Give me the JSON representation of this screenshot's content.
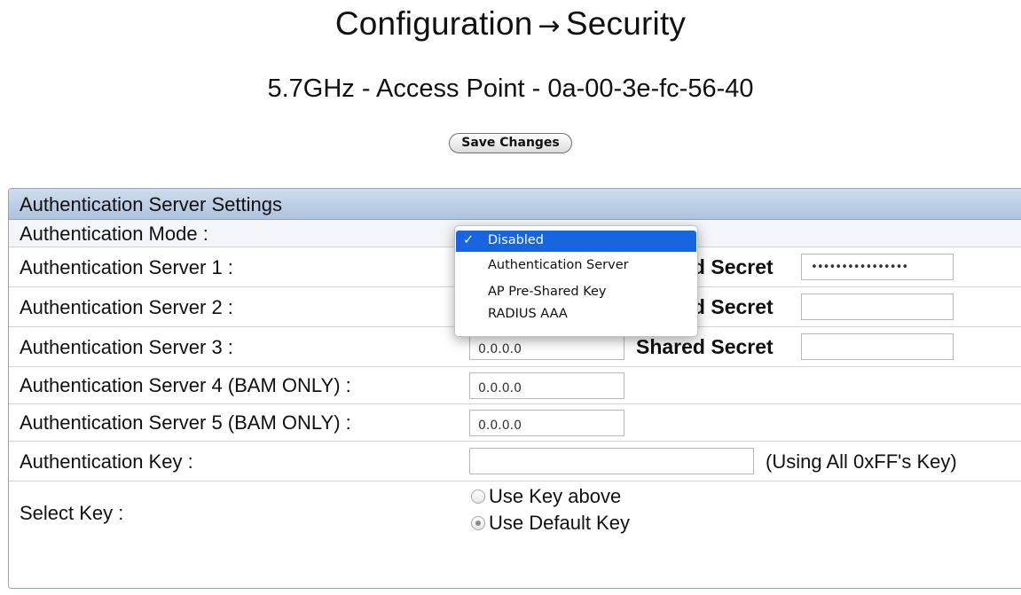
{
  "header": {
    "title_left": "Configuration",
    "title_arrow": "→",
    "title_right": "Security",
    "device": "5.7GHz - Access Point - 0a-00-3e-fc-56-40"
  },
  "toolbar": {
    "save_label": "Save Changes"
  },
  "panel": {
    "title": "Authentication Server Settings",
    "mode_label": "Authentication Mode :",
    "servers": [
      {
        "label": "Authentication Server 1 :",
        "value": "",
        "secret_label": "Shared Secret",
        "secret_value": "••••••••••••••••"
      },
      {
        "label": "Authentication Server 2 :",
        "value": "",
        "secret_label": "Shared Secret",
        "secret_value": ""
      },
      {
        "label": "Authentication Server 3 :",
        "value": "0.0.0.0",
        "secret_label": "Shared Secret",
        "secret_value": ""
      },
      {
        "label": "Authentication Server 4 (BAM ONLY) :",
        "value": "0.0.0.0"
      },
      {
        "label": "Authentication Server 5 (BAM ONLY) :",
        "value": "0.0.0.0"
      }
    ],
    "auth_key": {
      "label": "Authentication Key :",
      "value": "",
      "note": "(Using All 0xFF's Key)"
    },
    "select_key": {
      "label": "Select Key :",
      "options": [
        {
          "label": "Use Key above",
          "checked": false
        },
        {
          "label": "Use Default Key",
          "checked": true
        }
      ]
    }
  },
  "mode_dropdown": {
    "checkmark": "✓",
    "selected": "Disabled",
    "options": [
      "Disabled",
      "Authentication Server",
      "AP Pre-Shared Key",
      "RADIUS AAA"
    ]
  },
  "colors": {
    "header_gradient_top": "#cfdcee",
    "header_gradient_bottom": "#aec3dd",
    "menu_highlight": "#1765e0"
  }
}
